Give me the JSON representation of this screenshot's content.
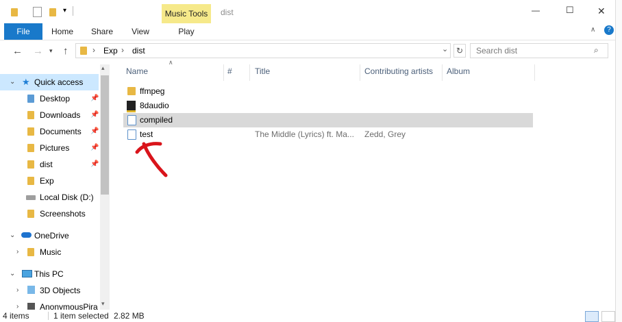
{
  "window": {
    "title": "dist",
    "contextual_tab_group": "Music Tools",
    "controls": {
      "minimize": "—",
      "maximize": "☐",
      "close": "✕"
    }
  },
  "ribbon": {
    "tabs": [
      "File",
      "Home",
      "Share",
      "View",
      "Play"
    ],
    "active_tab": "File"
  },
  "address": {
    "breadcrumb": [
      "Exp",
      "dist"
    ],
    "search_placeholder": "Search dist"
  },
  "sidebar": {
    "items": [
      {
        "label": "Quick access",
        "level": 0,
        "pinned": false,
        "expanded": true,
        "icon": "star-icon"
      },
      {
        "label": "Desktop",
        "level": 1,
        "pinned": true,
        "icon": "folder-icon"
      },
      {
        "label": "Downloads",
        "level": 1,
        "pinned": true,
        "icon": "download-folder-icon"
      },
      {
        "label": "Documents",
        "level": 1,
        "pinned": true,
        "icon": "document-folder-icon"
      },
      {
        "label": "Pictures",
        "level": 1,
        "pinned": true,
        "icon": "pictures-folder-icon"
      },
      {
        "label": "dist",
        "level": 1,
        "pinned": true,
        "icon": "folder-icon"
      },
      {
        "label": "Exp",
        "level": 1,
        "pinned": false,
        "icon": "folder-icon"
      },
      {
        "label": "Local Disk (D:)",
        "level": 1,
        "pinned": false,
        "icon": "drive-icon"
      },
      {
        "label": "Screenshots",
        "level": 1,
        "pinned": false,
        "icon": "folder-icon"
      },
      {
        "label": "OneDrive",
        "level": 0,
        "pinned": false,
        "expanded": true,
        "icon": "cloud-icon"
      },
      {
        "label": "Music",
        "level": 1,
        "pinned": false,
        "icon": "folder-icon"
      },
      {
        "label": "This PC",
        "level": 0,
        "pinned": false,
        "expanded": true,
        "icon": "computer-icon"
      },
      {
        "label": "3D Objects",
        "level": 1,
        "pinned": false,
        "icon": "3d-objects-icon"
      },
      {
        "label": "AnonymousPira",
        "level": 1,
        "pinned": false,
        "icon": "network-drive-icon"
      }
    ]
  },
  "columns": [
    "Name",
    "#",
    "Title",
    "Contributing artists",
    "Album"
  ],
  "files": [
    {
      "name": "ffmpeg",
      "num": "",
      "title": "",
      "artists": "",
      "album": "",
      "selected": false,
      "icon": "folder-icon"
    },
    {
      "name": "8daudio",
      "num": "",
      "title": "",
      "artists": "",
      "album": "",
      "selected": false,
      "icon": "app-icon"
    },
    {
      "name": "compiled",
      "num": "",
      "title": "",
      "artists": "",
      "album": "",
      "selected": true,
      "icon": "audio-file-icon"
    },
    {
      "name": "test",
      "num": "",
      "title": "The Middle (Lyrics) ft. Ma...",
      "artists": "Zedd, Grey",
      "album": "",
      "selected": false,
      "icon": "audio-file-icon"
    }
  ],
  "status": {
    "item_count": "4 items",
    "selection": "1 item selected",
    "size": "2.82 MB"
  },
  "annotation": {
    "shape": "red-arrow",
    "color": "#d9141b",
    "points_to": "test"
  }
}
